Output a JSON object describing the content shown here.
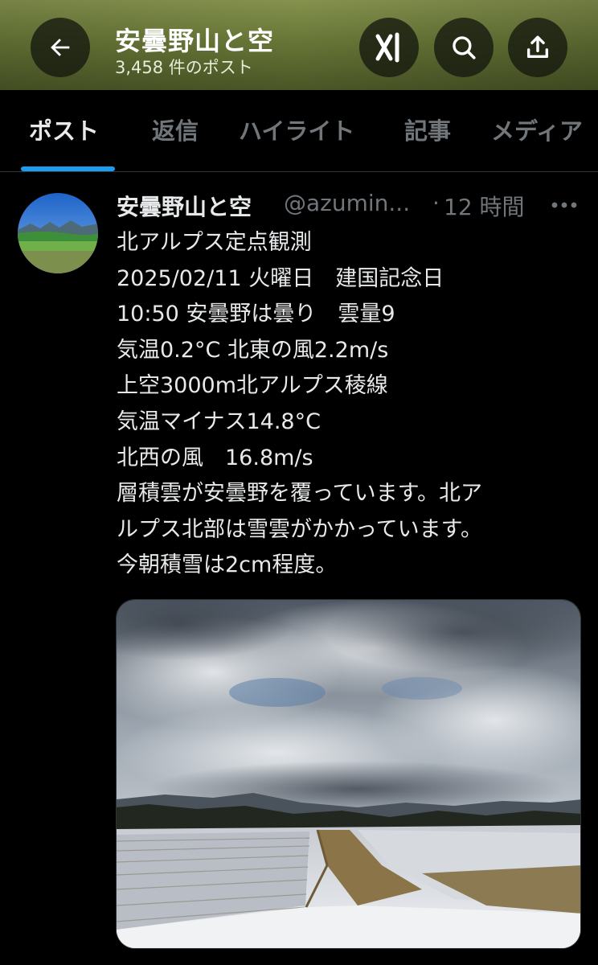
{
  "header": {
    "title": "安曇野山と空",
    "post_count": "3,458 件のポスト",
    "background_color": "#7a8a44",
    "icons": [
      "back-arrow-icon",
      "grok-icon",
      "search-icon",
      "share-icon"
    ]
  },
  "tabs": [
    {
      "label": "ポスト",
      "active": true
    },
    {
      "label": "返信",
      "active": false
    },
    {
      "label": "ハイライト",
      "active": false
    },
    {
      "label": "記事",
      "active": false
    },
    {
      "label": "メディア",
      "active": false
    }
  ],
  "accent_color": "#1d9bf0",
  "post": {
    "author": "安曇野山と空",
    "handle": "@azumin...",
    "separator": "·",
    "time": "12 時間",
    "lines": [
      "北アルプス定点観測",
      "2025/02/11 火曜日　建国記念日",
      "10:50 安曇野は曇り　雲量9",
      "気温0.2°C 北東の風2.2m/s",
      "上空3000m北アルプス稜線",
      "気温マイナス14.8°C",
      "北西の風　16.8m/s",
      "層積雲が安曇野を覆っています。北ア",
      "ルプス北部は雪雲がかかっています。",
      "今朝積雪は2cm程度。"
    ]
  }
}
